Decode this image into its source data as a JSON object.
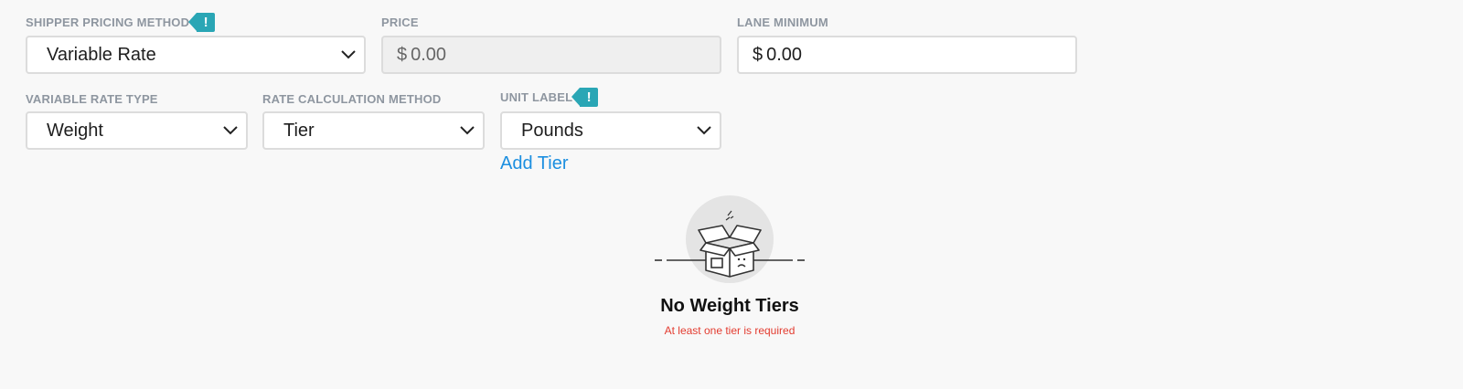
{
  "shipper_pricing": {
    "label": "SHIPPER PRICING METHOD",
    "alert_icon": "exclamation-tag-icon",
    "value": "Variable Rate"
  },
  "price": {
    "label": "PRICE",
    "currency": "$",
    "value": "0.00"
  },
  "lane_minimum": {
    "label": "LANE MINIMUM",
    "currency": "$",
    "value": "0.00"
  },
  "variable_rate_type": {
    "label": "VARIABLE RATE TYPE",
    "value": "Weight"
  },
  "rate_calc_method": {
    "label": "RATE CALCULATION METHOD",
    "value": "Tier"
  },
  "unit_label": {
    "label": "UNIT LABEL",
    "alert_icon": "exclamation-tag-icon",
    "value": "Pounds"
  },
  "add_tier_link": "Add Tier",
  "empty_state": {
    "icon": "empty-box-icon",
    "title": "No Weight Tiers",
    "message": "At least one tier is required"
  },
  "colors": {
    "accent_tag": "#2aa6b5",
    "link": "#1c8fe0",
    "error": "#e33c30"
  }
}
